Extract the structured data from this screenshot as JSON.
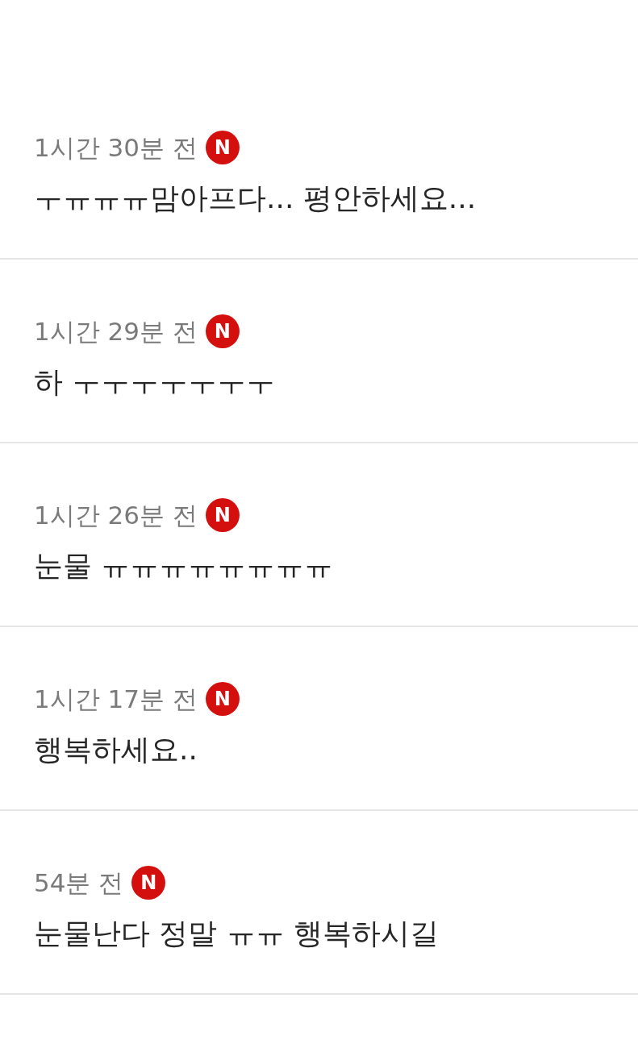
{
  "comments": [
    {
      "time": "1시간 30분 전",
      "badge": "N",
      "text": "ㅜㅠㅠㅠ맘아프다... 평안하세요..."
    },
    {
      "time": "1시간 29분 전",
      "badge": "N",
      "text": "하 ㅜㅜㅜㅜㅜㅜㅜ"
    },
    {
      "time": "1시간 26분 전",
      "badge": "N",
      "text": "눈물 ㅠㅠㅠㅠㅠㅠㅠㅠ"
    },
    {
      "time": "1시간 17분 전",
      "badge": "N",
      "text": "행복하세요.."
    },
    {
      "time": "54분 전",
      "badge": "N",
      "text": "눈물난다 정말 ㅠㅠ 행복하시길"
    }
  ]
}
